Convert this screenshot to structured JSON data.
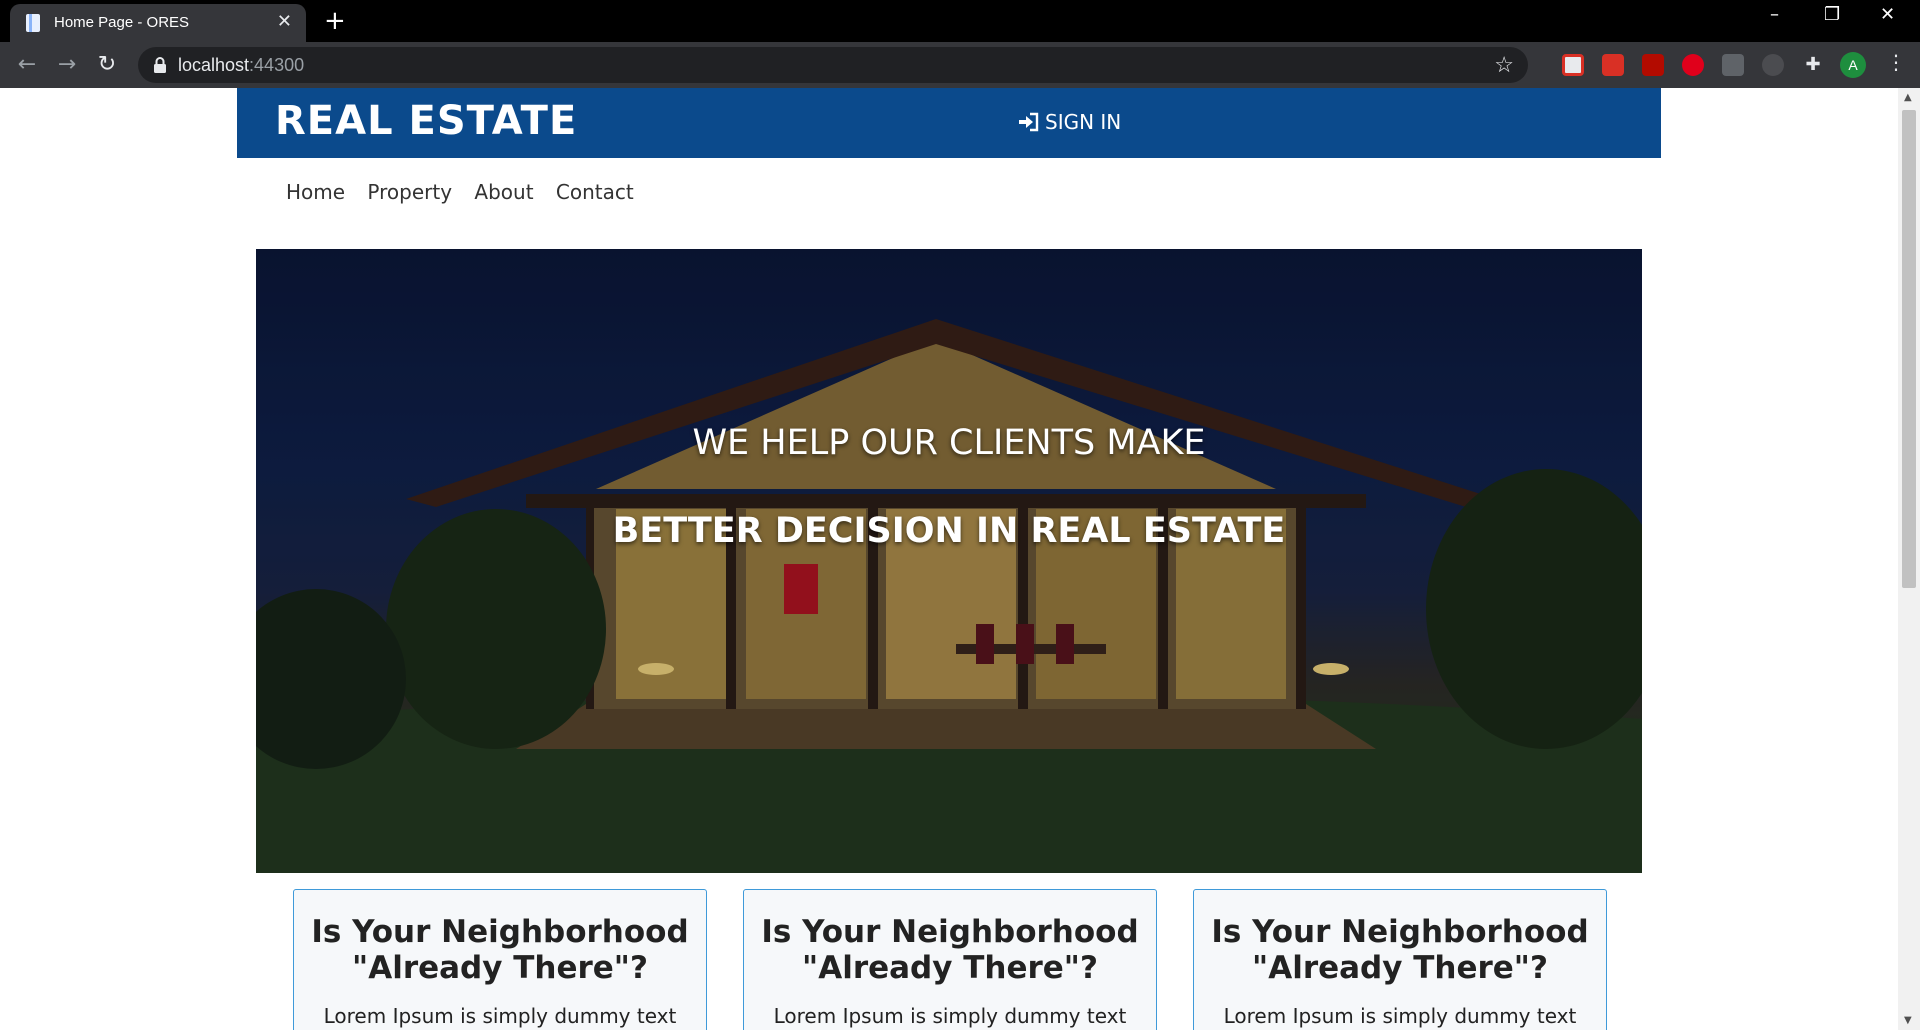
{
  "browser": {
    "tab_title": "Home Page - ORES",
    "url_host": "localhost",
    "url_port": ":44300",
    "avatar_letter": "A"
  },
  "site": {
    "brand": "REAL ESTATE",
    "sign_in": "SIGN IN",
    "nav": [
      "Home",
      "Property",
      "About",
      "Contact"
    ],
    "hero_line1": "WE HELP OUR CLIENTS MAKE",
    "hero_line2": "BETTER DECISION IN REAL ESTATE",
    "cards": [
      {
        "title_1": "Is Your Neighborhood",
        "title_2": "\"Already There\"?",
        "text": "Lorem Ipsum is simply dummy text"
      },
      {
        "title_1": "Is Your Neighborhood",
        "title_2": "\"Already There\"?",
        "text": "Lorem Ipsum is simply dummy text"
      },
      {
        "title_1": "Is Your Neighborhood",
        "title_2": "\"Already There\"?",
        "text": "Lorem Ipsum is simply dummy text"
      }
    ]
  },
  "colors": {
    "header_bg": "#0b4a8c",
    "card_border": "#3f9ad9"
  }
}
